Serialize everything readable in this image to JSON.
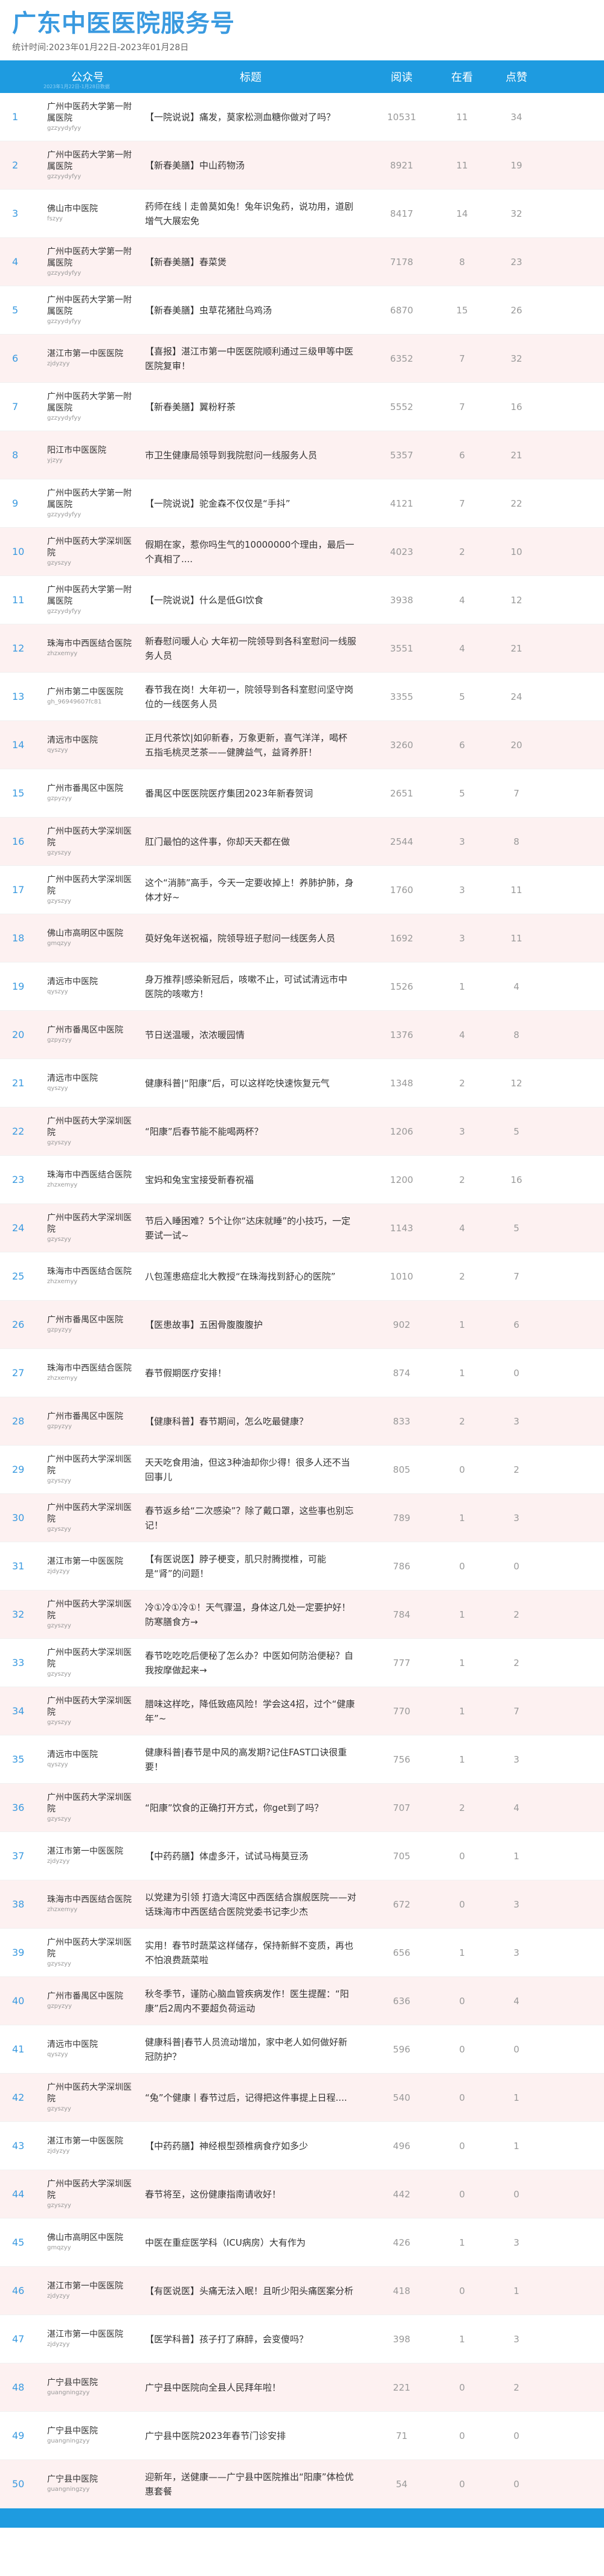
{
  "header": {
    "title": "广东中医医院服务号",
    "subtitle": "统计时间:2023年01月22日-2023年01月28日"
  },
  "table": {
    "columns": [
      "",
      "公众号",
      "标题",
      "阅读",
      "在看",
      "点赞"
    ],
    "header_note": "2023年1月22日-1月28日数据"
  },
  "rows": [
    {
      "rank": "1",
      "name": "广州中医药大学第一附属医院",
      "id": "gzzyydyfyy",
      "title": "【一院说说】痛发，莫家松测血糖你做对了吗？",
      "read": "10531",
      "look": "11",
      "like": "34"
    },
    {
      "rank": "2",
      "name": "广州中医药大学第一附属医院",
      "id": "gzzyydyfyy",
      "title": "【新春美膳】中山药物汤",
      "read": "8921",
      "look": "11",
      "like": "19"
    },
    {
      "rank": "3",
      "name": "佛山市中医院",
      "id": "fszyy",
      "title": "药师在线丨走兽莫如兔！兔年识兔药，说功用，道剧增气大展宏免",
      "read": "8417",
      "look": "14",
      "like": "32"
    },
    {
      "rank": "4",
      "name": "广州中医药大学第一附属医院",
      "id": "gzzyydyfyy",
      "title": "【新春美膳】春菜煲",
      "read": "7178",
      "look": "8",
      "like": "23"
    },
    {
      "rank": "5",
      "name": "广州中医药大学第一附属医院",
      "id": "gzzyydyfyy",
      "title": "【新春美膳】虫草花猪肚乌鸡汤",
      "read": "6870",
      "look": "15",
      "like": "26"
    },
    {
      "rank": "6",
      "name": "湛江市第一中医医院",
      "id": "zjdyzyy",
      "title": "【喜报】湛江市第一中医医院顺利通过三级甲等中医医院复审！",
      "read": "6352",
      "look": "7",
      "like": "32"
    },
    {
      "rank": "7",
      "name": "广州中医药大学第一附属医院",
      "id": "gzzyydyfyy",
      "title": "【新春美膳】翼粉籽茶",
      "read": "5552",
      "look": "7",
      "like": "16"
    },
    {
      "rank": "8",
      "name": "阳江市中医医院",
      "id": "yjzyy",
      "title": "市卫生健康局领导到我院慰问一线服务人员",
      "read": "5357",
      "look": "6",
      "like": "21"
    },
    {
      "rank": "9",
      "name": "广州中医药大学第一附属医院",
      "id": "gzzyydyfyy",
      "title": "【一院说说】驼金森不仅仅是“手抖”",
      "read": "4121",
      "look": "7",
      "like": "22"
    },
    {
      "rank": "10",
      "name": "广州中医药大学深圳医院",
      "id": "gzyszyy",
      "title": "假期在家，惹你吗生气的10000000个理由，最后一个真相了....",
      "read": "4023",
      "look": "2",
      "like": "10"
    },
    {
      "rank": "11",
      "name": "广州中医药大学第一附属医院",
      "id": "gzzyydyfyy",
      "title": "【一院说说】什么是低GI饮食",
      "read": "3938",
      "look": "4",
      "like": "12"
    },
    {
      "rank": "12",
      "name": "珠海市中西医结合医院",
      "id": "zhzxemyy",
      "title": "新春慰问暖人心 大年初一院领导到各科室慰问一线服务人员",
      "read": "3551",
      "look": "4",
      "like": "21"
    },
    {
      "rank": "13",
      "name": "广州市第二中医医院",
      "id": "gh_96949607fc81",
      "title": "春节我在岗！大年初一，院领导到各科室慰问坚守岗位的一线医务人员",
      "read": "3355",
      "look": "5",
      "like": "24"
    },
    {
      "rank": "14",
      "name": "清远市中医院",
      "id": "qyszyy",
      "title": "正月代茶饮|如卯新春，万象更新，喜气洋洋，喝杯五指毛桃灵芝茶——健脾益气，益肾养肝！",
      "read": "3260",
      "look": "6",
      "like": "20"
    },
    {
      "rank": "15",
      "name": "广州市番禺区中医院",
      "id": "gzpyzyy",
      "title": "番禺区中医医院医疗集团2023年新春贺词",
      "read": "2651",
      "look": "5",
      "like": "7"
    },
    {
      "rank": "16",
      "name": "广州中医药大学深圳医院",
      "id": "gzyszyy",
      "title": "肛门最怕的这件事，你却天天都在做",
      "read": "2544",
      "look": "3",
      "like": "8"
    },
    {
      "rank": "17",
      "name": "广州中医药大学深圳医院",
      "id": "gzyszyy",
      "title": "这个“消肺”高手，今天一定要收掉上！养肺护肺，身体才好~",
      "read": "1760",
      "look": "3",
      "like": "11"
    },
    {
      "rank": "18",
      "name": "佛山市高明区中医院",
      "id": "gmqzyy",
      "title": "萸好兔年送祝福，院领导班子慰问一线医务人员",
      "read": "1692",
      "look": "3",
      "like": "11"
    },
    {
      "rank": "19",
      "name": "清远市中医院",
      "id": "qyszyy",
      "title": "身万推荐|感染新冠后，咳嗽不止，可试试清远市中医院的咳嗽方！",
      "read": "1526",
      "look": "1",
      "like": "4"
    },
    {
      "rank": "20",
      "name": "广州市番禺区中医院",
      "id": "gzpyzyy",
      "title": "节日送温暖，浓浓暖园情",
      "read": "1376",
      "look": "4",
      "like": "8"
    },
    {
      "rank": "21",
      "name": "清远市中医院",
      "id": "qyszyy",
      "title": "健康科普|“阳康”后，可以这样吃快速恢复元气",
      "read": "1348",
      "look": "2",
      "like": "12"
    },
    {
      "rank": "22",
      "name": "广州中医药大学深圳医院",
      "id": "gzyszyy",
      "title": "“阳康”后春节能不能喝两杯？",
      "read": "1206",
      "look": "3",
      "like": "5"
    },
    {
      "rank": "23",
      "name": "珠海市中西医结合医院",
      "id": "zhzxemyy",
      "title": "宝妈和兔宝宝接受新春祝福",
      "read": "1200",
      "look": "2",
      "like": "16"
    },
    {
      "rank": "24",
      "name": "广州中医药大学深圳医院",
      "id": "gzyszyy",
      "title": "节后入睡困难？5个让你“达床就睡”的小技巧，一定要试一试~",
      "read": "1143",
      "look": "4",
      "like": "5"
    },
    {
      "rank": "25",
      "name": "珠海市中西医结合医院",
      "id": "zhzxemyy",
      "title": "八包莲患癌症北大教授“在珠海找到舒心的医院”",
      "read": "1010",
      "look": "2",
      "like": "7"
    },
    {
      "rank": "26",
      "name": "广州市番禺区中医院",
      "id": "gzpyzyy",
      "title": "【医患故事】五困骨腹腹腹护",
      "read": "902",
      "look": "1",
      "like": "6"
    },
    {
      "rank": "27",
      "name": "珠海市中西医结合医院",
      "id": "zhzxemyy",
      "title": "春节假期医疗安排！",
      "read": "874",
      "look": "1",
      "like": "0"
    },
    {
      "rank": "28",
      "name": "广州市番禺区中医院",
      "id": "gzpyzyy",
      "title": "【健康科普】春节期间，怎么吃最健康？",
      "read": "833",
      "look": "2",
      "like": "3"
    },
    {
      "rank": "29",
      "name": "广州中医药大学深圳医院",
      "id": "gzyszyy",
      "title": "天天吃食用油，但这3种油却你少得！很多人还不当回事儿",
      "read": "805",
      "look": "0",
      "like": "2"
    },
    {
      "rank": "30",
      "name": "广州中医药大学深圳医院",
      "id": "gzyszyy",
      "title": "春节返乡给“二次感染”？除了戴口罩，这些事也别忘记！",
      "read": "789",
      "look": "1",
      "like": "3"
    },
    {
      "rank": "31",
      "name": "湛江市第一中医医院",
      "id": "zjdyzyy",
      "title": "【有医说医】脖子梗变，肌只肘腾搅椎，可能是“肾”的问题！",
      "read": "786",
      "look": "0",
      "like": "0"
    },
    {
      "rank": "32",
      "name": "广州中医药大学深圳医院",
      "id": "gzyszyy",
      "title": "冷①冷①冷①！天气骤温，身体这几处一定要护好！防寒膳食方→",
      "read": "784",
      "look": "1",
      "like": "2"
    },
    {
      "rank": "33",
      "name": "广州中医药大学深圳医院",
      "id": "gzyszyy",
      "title": "春节吃吃吃后便秘了怎么办？中医如何防治便秘？自我按摩做起来→",
      "read": "777",
      "look": "1",
      "like": "2"
    },
    {
      "rank": "34",
      "name": "广州中医药大学深圳医院",
      "id": "gzyszyy",
      "title": "腊味这样吃，降低致癌风险！学会这4招，过个“健康年”~",
      "read": "770",
      "look": "1",
      "like": "7"
    },
    {
      "rank": "35",
      "name": "清远市中医院",
      "id": "qyszyy",
      "title": "健康科普|春节是中风的高发期?记住FAST口诀很重要！",
      "read": "756",
      "look": "1",
      "like": "3"
    },
    {
      "rank": "36",
      "name": "广州中医药大学深圳医院",
      "id": "gzyszyy",
      "title": "“阳康”饮食的正确打开方式，你get到了吗？",
      "read": "707",
      "look": "2",
      "like": "4"
    },
    {
      "rank": "37",
      "name": "湛江市第一中医医院",
      "id": "zjdyzyy",
      "title": "【中药药膳】体虚多汗，试试马梅莫豆汤",
      "read": "705",
      "look": "0",
      "like": "1"
    },
    {
      "rank": "38",
      "name": "珠海市中西医结合医院",
      "id": "zhzxemyy",
      "title": "以党建为引领 打造大湾区中西医结合旗舰医院——对话珠海市中西医结合医院党委书记李少杰",
      "read": "672",
      "look": "0",
      "like": "3"
    },
    {
      "rank": "39",
      "name": "广州中医药大学深圳医院",
      "id": "gzyszyy",
      "title": "实用！春节时蔬菜这样储存，保持新鲜不变质，再也不怕浪费蔬菜啦",
      "read": "656",
      "look": "1",
      "like": "3"
    },
    {
      "rank": "40",
      "name": "广州市番禺区中医院",
      "id": "gzpyzyy",
      "title": "秋冬季节，谨防心脑血管疾病发作！医生提醒：“阳康”后2周内不要超负荷运动",
      "read": "636",
      "look": "0",
      "like": "4"
    },
    {
      "rank": "41",
      "name": "清远市中医院",
      "id": "qyszyy",
      "title": "健康科普|春节人员流动增加，家中老人如何做好新冠防护？",
      "read": "596",
      "look": "0",
      "like": "0"
    },
    {
      "rank": "42",
      "name": "广州中医药大学深圳医院",
      "id": "gzyszyy",
      "title": "“兔”个健康丨春节过后，记得把这件事提上日程....",
      "read": "540",
      "look": "0",
      "like": "1"
    },
    {
      "rank": "43",
      "name": "湛江市第一中医医院",
      "id": "zjdyzyy",
      "title": "【中药药膳】神经根型颈椎病食疗如多少",
      "read": "496",
      "look": "0",
      "like": "1"
    },
    {
      "rank": "44",
      "name": "广州中医药大学深圳医院",
      "id": "gzyszyy",
      "title": "春节将至，这份健康指南请收好！",
      "read": "442",
      "look": "0",
      "like": "0"
    },
    {
      "rank": "45",
      "name": "佛山市高明区中医院",
      "id": "gmqzyy",
      "title": "中医在重症医学科（ICU病房）大有作为",
      "read": "426",
      "look": "1",
      "like": "3"
    },
    {
      "rank": "46",
      "name": "湛江市第一中医医院",
      "id": "zjdyzyy",
      "title": "【有医说医】头痛无法入眠！且听少阳头痛医案分析",
      "read": "418",
      "look": "0",
      "like": "1"
    },
    {
      "rank": "47",
      "name": "湛江市第一中医医院",
      "id": "zjdyzyy",
      "title": "【医学科普】孩子打了麻醉，会变傻吗？",
      "read": "398",
      "look": "1",
      "like": "3"
    },
    {
      "rank": "48",
      "name": "广宁县中医院",
      "id": "guangningzyy",
      "title": "广宁县中医院向全县人民拜年啦！",
      "read": "221",
      "look": "0",
      "like": "2"
    },
    {
      "rank": "49",
      "name": "广宁县中医院",
      "id": "guangningzyy",
      "title": "广宁县中医院2023年春节门诊安排",
      "read": "71",
      "look": "0",
      "like": "0"
    },
    {
      "rank": "50",
      "name": "广宁县中医院",
      "id": "guangningzyy",
      "title": "迎新年，送健康——广宁县中医院推出“阳康”体检优惠套餐",
      "read": "54",
      "look": "0",
      "like": "0"
    }
  ]
}
